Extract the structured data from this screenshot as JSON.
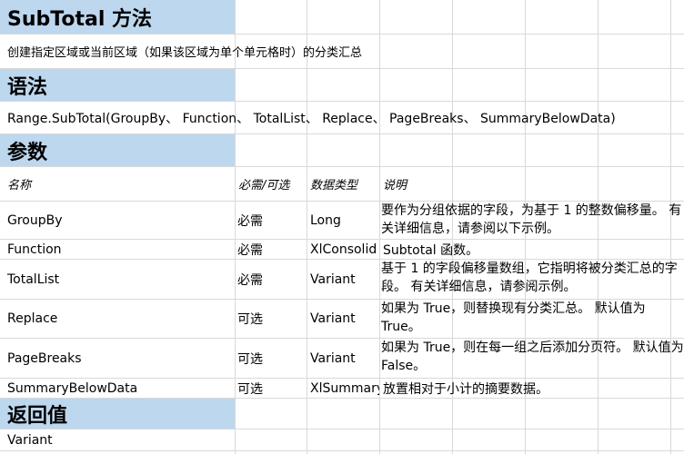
{
  "title": "SubTotal 方法",
  "description": "创建指定区域或当前区域（如果该区域为单个单元格时）的分类汇总",
  "syntax_header": "语法",
  "syntax": "Range.SubTotal(GroupBy、 Function、 TotalList、 Replace、 PageBreaks、 SummaryBelowData)",
  "params_header": "参数",
  "columns": {
    "name": "名称",
    "required": "必需/可选",
    "type": "数据类型",
    "desc": "说明"
  },
  "params": [
    {
      "name": "GroupBy",
      "required": "必需",
      "type": "Long",
      "desc": "要作为分组依据的字段，为基于 1 的整数偏移量。 有关详细信息，请参阅以下示例。"
    },
    {
      "name": "Function",
      "required": "必需",
      "type": "XlConsolid",
      "desc": "Subtotal 函数。"
    },
    {
      "name": "TotalList",
      "required": "必需",
      "type": "Variant",
      "desc": "基于 1 的字段偏移量数组，它指明将被分类汇总的字段。 有关详细信息，请参阅示例。"
    },
    {
      "name": "Replace",
      "required": "可选",
      "type": "Variant",
      "desc": "如果为 True，则替换现有分类汇总。 默认值为 True。"
    },
    {
      "name": "PageBreaks",
      "required": "可选",
      "type": "Variant",
      "desc": "如果为 True，则在每一组之后添加分页符。 默认值为 False。"
    },
    {
      "name": "SummaryBelowData",
      "required": "可选",
      "type": "XlSummary",
      "desc": "放置相对于小计的摘要数据。"
    }
  ],
  "return_header": "返回值",
  "return_value": "Variant"
}
